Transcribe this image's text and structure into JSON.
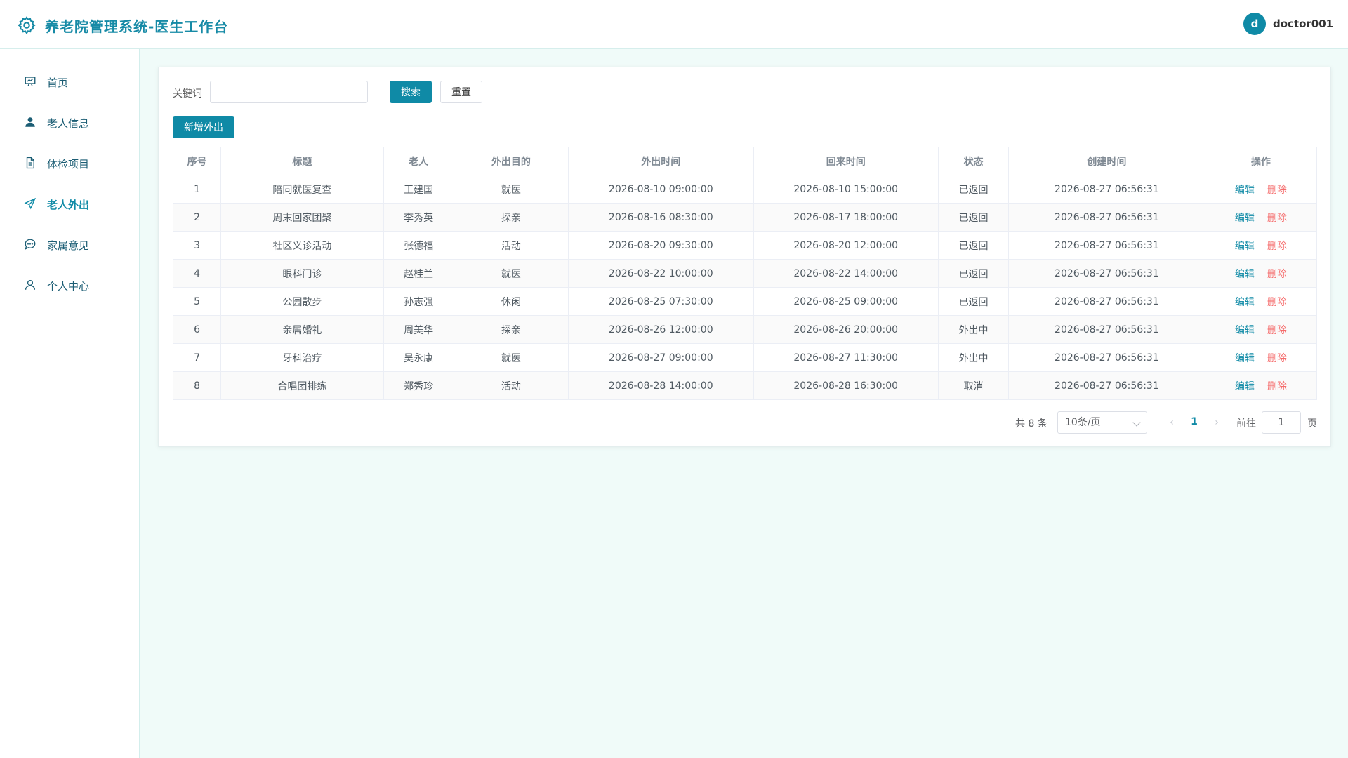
{
  "header": {
    "title": "养老院管理系统-医生工作台",
    "avatar_letter": "d",
    "username": "doctor001",
    "logo_icon": "gear-icon"
  },
  "sidebar": {
    "items": [
      {
        "label": "首页",
        "icon": "presentation-icon",
        "active": false
      },
      {
        "label": "老人信息",
        "icon": "user-icon",
        "active": false
      },
      {
        "label": "体检项目",
        "icon": "document-icon",
        "active": false
      },
      {
        "label": "老人外出",
        "icon": "send-icon",
        "active": true
      },
      {
        "label": "家属意见",
        "icon": "chat-icon",
        "active": false
      },
      {
        "label": "个人中心",
        "icon": "user-outline-icon",
        "active": false
      }
    ]
  },
  "search": {
    "label": "关键词",
    "value": "",
    "placeholder": "",
    "search_button": "搜索",
    "reset_button": "重置",
    "add_button": "新增外出"
  },
  "table": {
    "columns": [
      "序号",
      "标题",
      "老人",
      "外出目的",
      "外出时间",
      "回来时间",
      "状态",
      "创建时间",
      "操作"
    ],
    "edit_label": "编辑",
    "delete_label": "删除",
    "rows": [
      [
        "1",
        "陪同就医复查",
        "王建国",
        "就医",
        "2026-08-10 09:00:00",
        "2026-08-10 15:00:00",
        "已返回",
        "2026-08-27 06:56:31"
      ],
      [
        "2",
        "周末回家团聚",
        "李秀英",
        "探亲",
        "2026-08-16 08:30:00",
        "2026-08-17 18:00:00",
        "已返回",
        "2026-08-27 06:56:31"
      ],
      [
        "3",
        "社区义诊活动",
        "张德福",
        "活动",
        "2026-08-20 09:30:00",
        "2026-08-20 12:00:00",
        "已返回",
        "2026-08-27 06:56:31"
      ],
      [
        "4",
        "眼科门诊",
        "赵桂兰",
        "就医",
        "2026-08-22 10:00:00",
        "2026-08-22 14:00:00",
        "已返回",
        "2026-08-27 06:56:31"
      ],
      [
        "5",
        "公园散步",
        "孙志强",
        "休闲",
        "2026-08-25 07:30:00",
        "2026-08-25 09:00:00",
        "已返回",
        "2026-08-27 06:56:31"
      ],
      [
        "6",
        "亲属婚礼",
        "周美华",
        "探亲",
        "2026-08-26 12:00:00",
        "2026-08-26 20:00:00",
        "外出中",
        "2026-08-27 06:56:31"
      ],
      [
        "7",
        "牙科治疗",
        "吴永康",
        "就医",
        "2026-08-27 09:00:00",
        "2026-08-27 11:30:00",
        "外出中",
        "2026-08-27 06:56:31"
      ],
      [
        "8",
        "合唱团排练",
        "郑秀珍",
        "活动",
        "2026-08-28 14:00:00",
        "2026-08-28 16:30:00",
        "取消",
        "2026-08-27 06:56:31"
      ]
    ]
  },
  "pagination": {
    "total_text": "共 8 条",
    "page_size": "10条/页",
    "current_page": "1",
    "goto_label": "前往",
    "goto_value": "1",
    "page_suffix": "页"
  },
  "colors": {
    "accent": "#0f8aa6",
    "danger": "#f56c6c",
    "background": "#f0fbf9"
  }
}
